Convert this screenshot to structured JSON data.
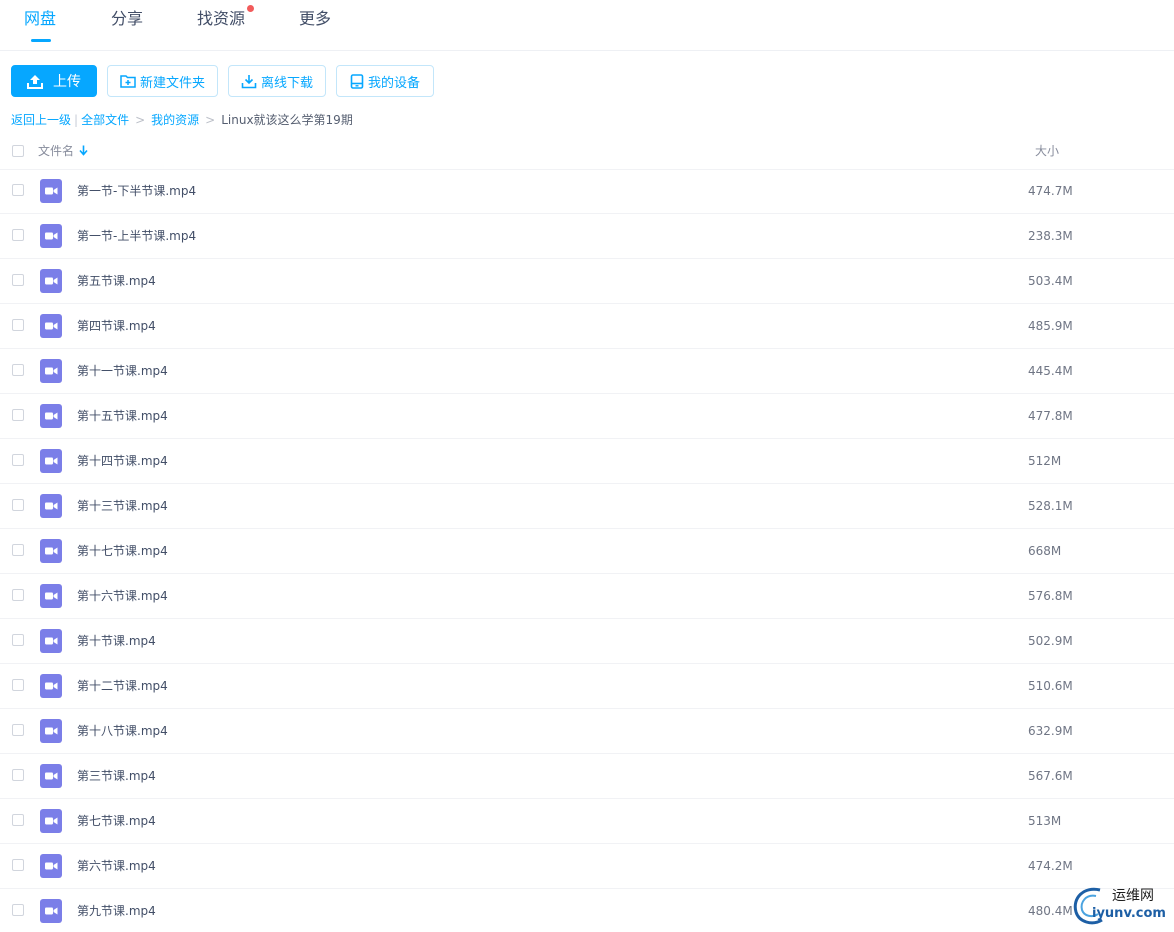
{
  "nav": {
    "tabs": [
      {
        "label": "网盘",
        "active": true
      },
      {
        "label": "分享",
        "active": false
      },
      {
        "label": "找资源",
        "active": false,
        "badge_dot": true
      },
      {
        "label": "更多",
        "active": false
      }
    ]
  },
  "toolbar": {
    "upload_label": "上传",
    "new_folder_label": "新建文件夹",
    "offline_download_label": "离线下载",
    "my_devices_label": "我的设备"
  },
  "breadcrumb": {
    "back_label": "返回上一级",
    "separator_pipe": "|",
    "all_files_label": "全部文件",
    "arrow": ">",
    "my_resources_label": "我的资源",
    "current_label": "Linux就该这么学第19期"
  },
  "list": {
    "header_name": "文件名",
    "header_size": "大小",
    "files": [
      {
        "name": "第一节-下半节课.mp4",
        "size": "474.7M"
      },
      {
        "name": "第一节-上半节课.mp4",
        "size": "238.3M"
      },
      {
        "name": "第五节课.mp4",
        "size": "503.4M"
      },
      {
        "name": "第四节课.mp4",
        "size": "485.9M"
      },
      {
        "name": "第十一节课.mp4",
        "size": "445.4M"
      },
      {
        "name": "第十五节课.mp4",
        "size": "477.8M"
      },
      {
        "name": "第十四节课.mp4",
        "size": "512M"
      },
      {
        "name": "第十三节课.mp4",
        "size": "528.1M"
      },
      {
        "name": "第十七节课.mp4",
        "size": "668M"
      },
      {
        "name": "第十六节课.mp4",
        "size": "576.8M"
      },
      {
        "name": "第十节课.mp4",
        "size": "502.9M"
      },
      {
        "name": "第十二节课.mp4",
        "size": "510.6M"
      },
      {
        "name": "第十八节课.mp4",
        "size": "632.9M"
      },
      {
        "name": "第三节课.mp4",
        "size": "567.6M"
      },
      {
        "name": "第七节课.mp4",
        "size": "513M"
      },
      {
        "name": "第六节课.mp4",
        "size": "474.2M"
      },
      {
        "name": "第九节课.mp4",
        "size": "480.4M"
      }
    ]
  },
  "watermark": {
    "text_top": "运维网",
    "text_bottom": "iyunv.com"
  },
  "colors": {
    "accent": "#06a7ff",
    "video_icon": "#7b7ee8",
    "badge_dot": "#f25b5b"
  },
  "icons": {
    "upload": "upload-icon",
    "new_folder": "folder-plus-icon",
    "offline_download": "download-icon",
    "my_devices": "device-icon",
    "sort": "arrow-down-icon",
    "file": "video-file-icon"
  }
}
